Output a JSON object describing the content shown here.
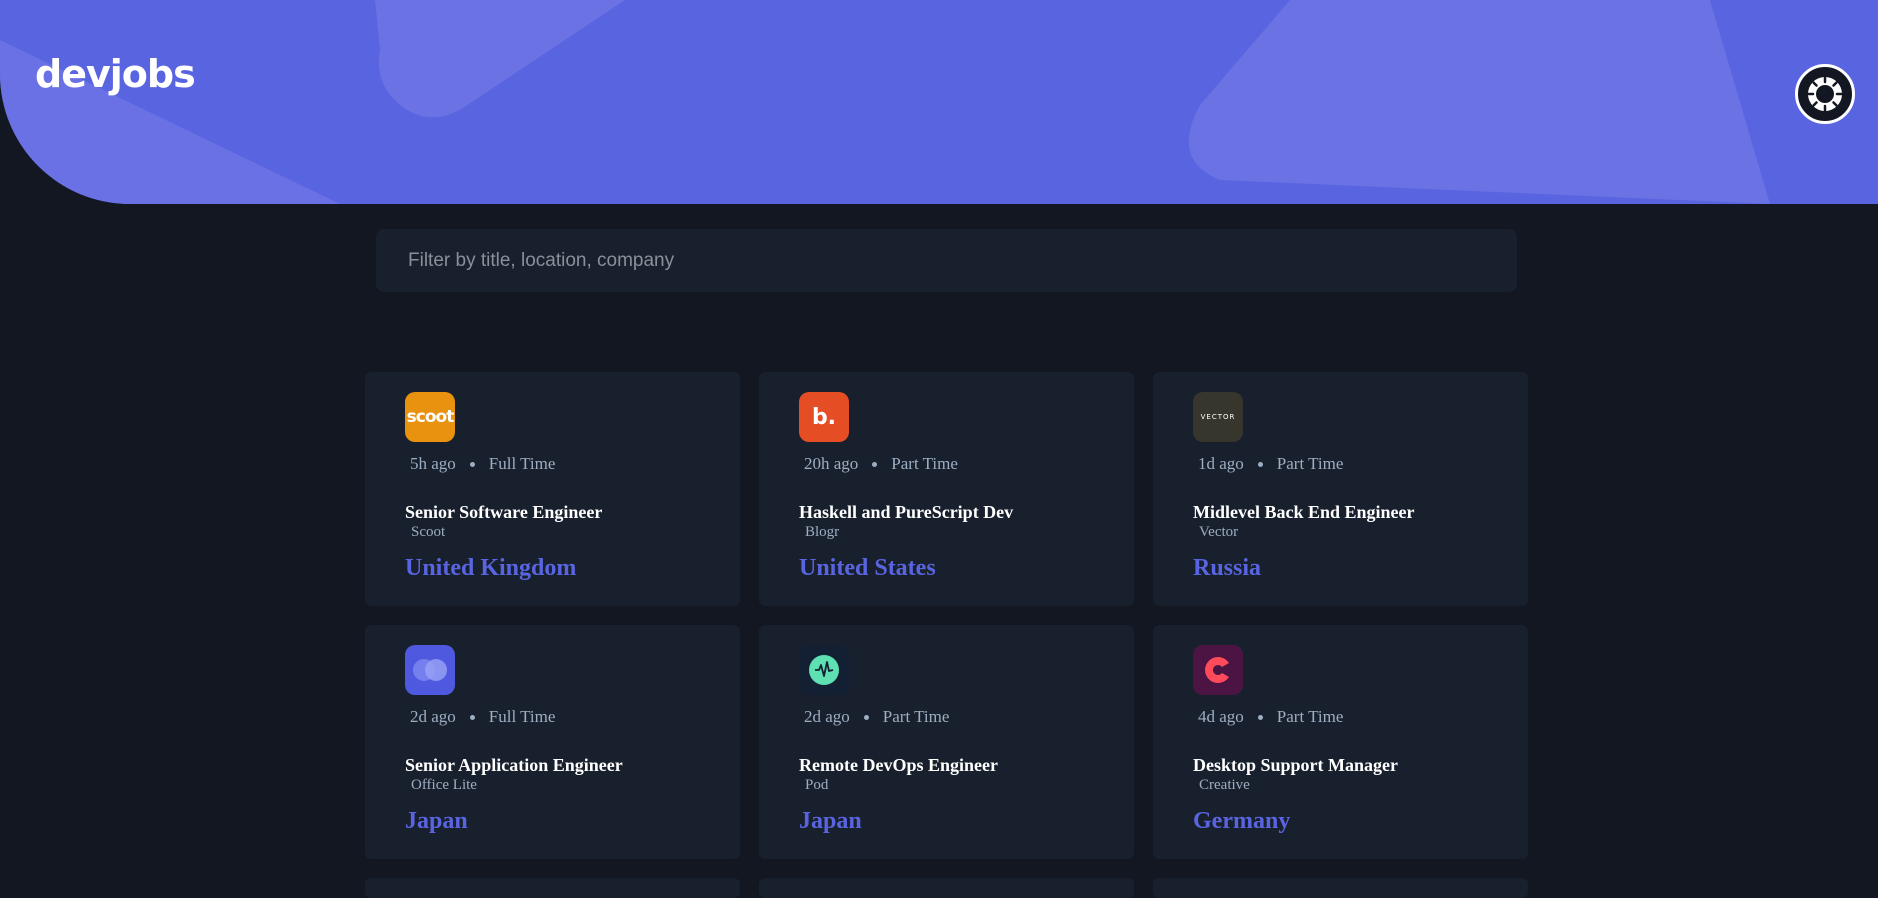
{
  "header": {
    "logo": "devjobs",
    "theme_toggle_icon": "sun-icon"
  },
  "search": {
    "placeholder": "Filter by title, location, company"
  },
  "jobs": [
    {
      "posted": "5h ago",
      "contract": "Full Time",
      "position": "Senior Software Engineer",
      "company": "Scoot",
      "location": "United Kingdom",
      "logo_text": "scoot",
      "logo_color": "#e99210"
    },
    {
      "posted": "20h ago",
      "contract": "Part Time",
      "position": "Haskell and PureScript Dev",
      "company": "Blogr",
      "location": "United States",
      "logo_text": "b.",
      "logo_color": "#e54d25"
    },
    {
      "posted": "1d ago",
      "contract": "Part Time",
      "position": "Midlevel Back End Engineer",
      "company": "Vector",
      "location": "Russia",
      "logo_text": "VECTOR",
      "logo_color": "#36362c"
    },
    {
      "posted": "2d ago",
      "contract": "Full Time",
      "position": "Senior Application Engineer",
      "company": "Office Lite",
      "location": "Japan",
      "logo_text": "",
      "logo_color": "#4e59e0"
    },
    {
      "posted": "2d ago",
      "contract": "Part Time",
      "position": "Remote DevOps Engineer",
      "company": "Pod",
      "location": "Japan",
      "logo_text": "",
      "logo_color": "#132034"
    },
    {
      "posted": "4d ago",
      "contract": "Part Time",
      "position": "Desktop Support Manager",
      "company": "Creative",
      "location": "Germany",
      "logo_text": "",
      "logo_color": "#4b1443"
    }
  ],
  "colors": {
    "brand": "#5964e0",
    "background": "#121721",
    "card": "#19202d"
  }
}
